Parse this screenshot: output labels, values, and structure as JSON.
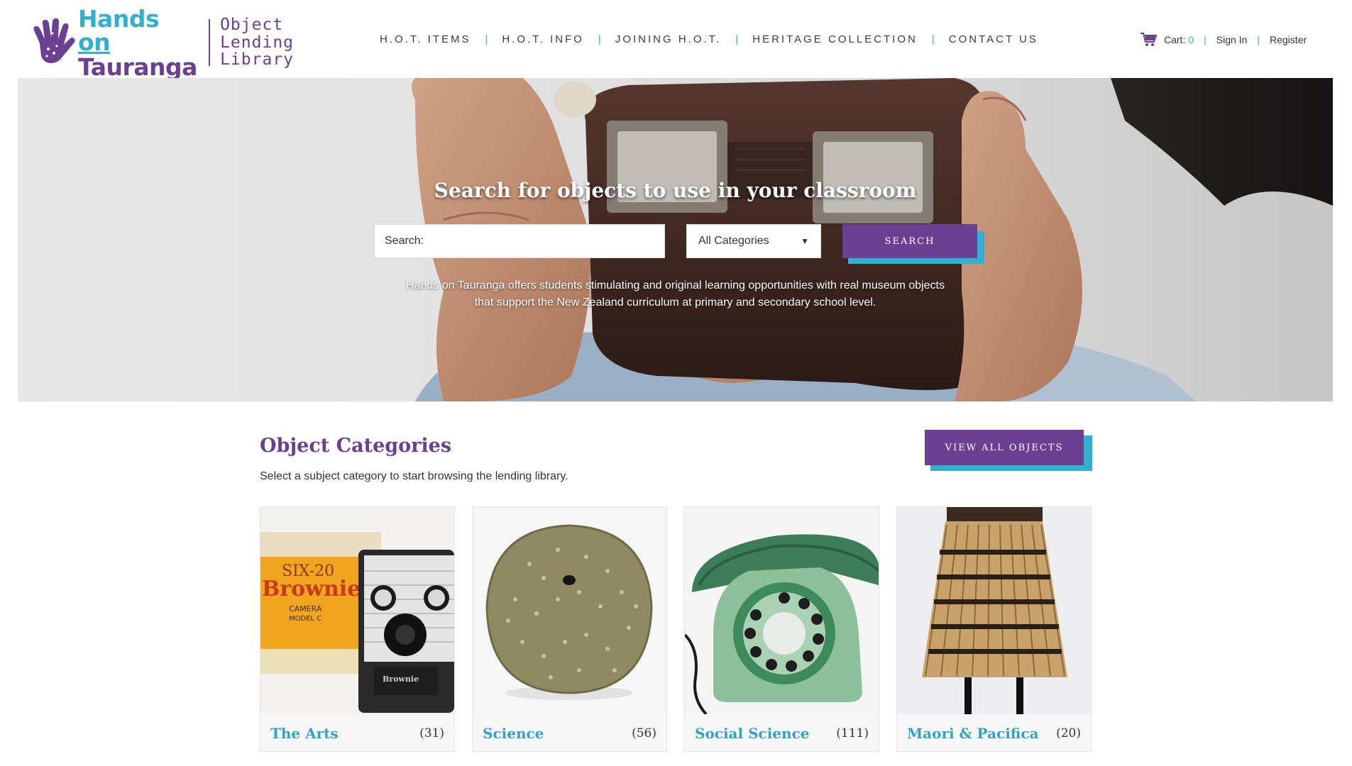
{
  "brand": {
    "name_line1": "Hands",
    "name_on": "on",
    "name_line2": "Tauranga",
    "sub_line1": "Object",
    "sub_line2": "Lending",
    "sub_line3": "Library",
    "primary_color": "#6b3f91",
    "accent_color": "#31b0cf"
  },
  "nav": {
    "items": [
      {
        "label": "H.O.T. ITEMS"
      },
      {
        "label": "H.O.T. INFO"
      },
      {
        "label": "JOINING H.O.T."
      },
      {
        "label": "HERITAGE COLLECTION"
      },
      {
        "label": "CONTACT US"
      }
    ],
    "separator": "|"
  },
  "account": {
    "cart_label": "Cart:",
    "cart_count": "0",
    "sign_in": "Sign In",
    "register": "Register",
    "cart_icon": "cart-icon"
  },
  "hero": {
    "title": "Search for objects to use in your classroom",
    "search_placeholder": "Search:",
    "category_selected": "All Categories",
    "search_button": "SEARCH",
    "description_line1": "Hands on Tauranga offers students stimulating and original learning opportunities with real museum objects",
    "description_line2": "that support the New Zealand curriculum at primary and secondary school level."
  },
  "categories": {
    "heading": "Object Categories",
    "subheading": "Select a subject category to start browsing the lending library.",
    "view_all": "VIEW ALL OBJECTS",
    "items": [
      {
        "name": "The Arts",
        "count": "(31)",
        "image_icon": "box-camera-icon"
      },
      {
        "name": "Science",
        "count": "(56)",
        "image_icon": "sea-urchin-icon"
      },
      {
        "name": "Social Science",
        "count": "(111)",
        "image_icon": "rotary-phone-icon"
      },
      {
        "name": "Maori & Pacifica",
        "count": "(20)",
        "image_icon": "piupiu-skirt-icon"
      }
    ],
    "camera_box_text": "SIX-20",
    "camera_box_brand": "Brownie",
    "camera_box_sub1": "CAMERA",
    "camera_box_sub2": "MODEL C",
    "camera_label": "Brownie"
  }
}
